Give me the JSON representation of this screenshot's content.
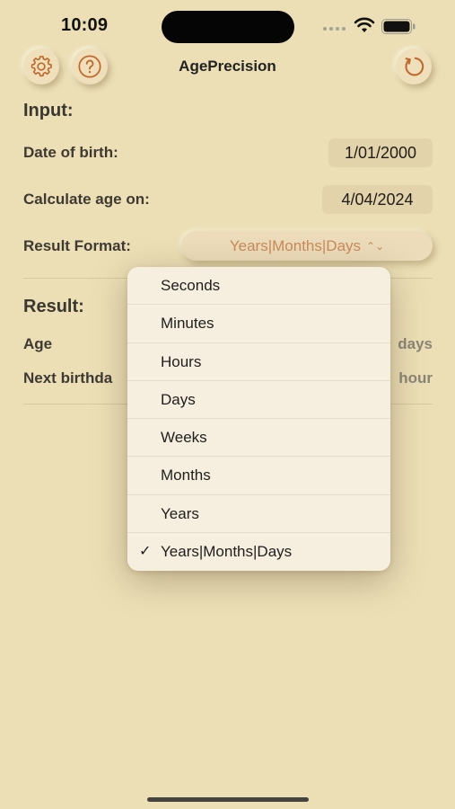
{
  "status_bar": {
    "time": "10:09"
  },
  "header": {
    "title": "AgePrecision",
    "settings_icon": "gear-icon",
    "help_icon": "question-mark-icon",
    "reset_icon": "refresh-icon"
  },
  "input": {
    "section_title": "Input:",
    "dob_label": "Date of birth:",
    "dob_value": "1/01/2000",
    "calc_label": "Calculate age on:",
    "calc_value": "4/04/2024",
    "format_label": "Result Format:",
    "format_value": "Years|Months|Days"
  },
  "result": {
    "section_title": "Result:",
    "age_label": "Age",
    "age_value_visible": "days",
    "next_birthday_label": "Next birthda",
    "next_birthday_value_visible": "hour"
  },
  "format_menu": {
    "items": [
      {
        "label": "Seconds",
        "selected": false
      },
      {
        "label": "Minutes",
        "selected": false
      },
      {
        "label": "Hours",
        "selected": false
      },
      {
        "label": "Days",
        "selected": false
      },
      {
        "label": "Weeks",
        "selected": false
      },
      {
        "label": "Months",
        "selected": false
      },
      {
        "label": "Years",
        "selected": false
      },
      {
        "label": "Years|Months|Days",
        "selected": true
      }
    ],
    "checkmark": "✓"
  },
  "colors": {
    "background": "#ecdfb6",
    "accent": "#c98a5c",
    "icon_accent": "#c0692e",
    "menu_bg": "#f6efdf"
  }
}
